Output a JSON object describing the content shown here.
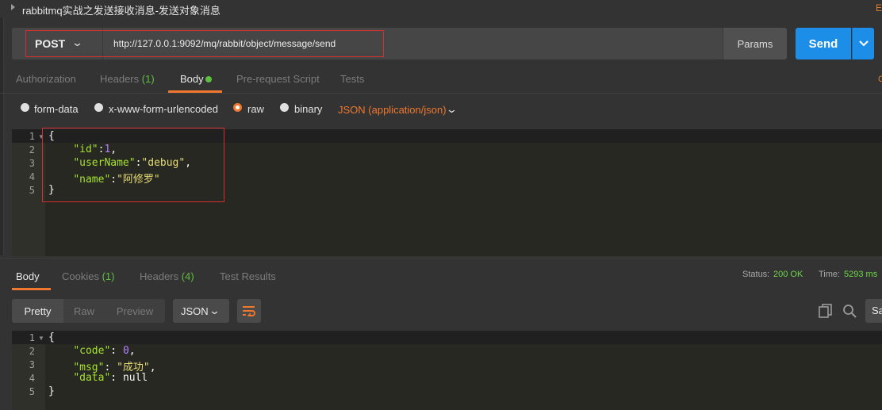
{
  "title": "rabbitmq实战之发送接收消息-发送对象消息",
  "title_right": "E",
  "request": {
    "method": "POST",
    "url": "http://127.0.0.1:9092/mq/rabbit/object/message/send",
    "params_label": "Params",
    "send_label": "Send"
  },
  "req_tabs": {
    "authorization": "Authorization",
    "headers": "Headers",
    "headers_count": "(1)",
    "body": "Body",
    "prerequest": "Pre-request Script",
    "tests": "Tests",
    "right_marker": "C"
  },
  "body_types": {
    "form_data": "form-data",
    "urlencoded": "x-www-form-urlencoded",
    "raw": "raw",
    "binary": "binary",
    "selected": "raw",
    "content_type": "JSON (application/json)"
  },
  "request_body": {
    "line_numbers": [
      "1",
      "2",
      "3",
      "4",
      "5"
    ],
    "l1": "{",
    "l2_key": "\"id\"",
    "l2_val": "1",
    "l3_key": "\"userName\"",
    "l3_val": "\"debug\"",
    "l4_key": "\"name\"",
    "l4_val": "\"阿修罗\"",
    "l5": "}"
  },
  "resp_tabs": {
    "body": "Body",
    "cookies": "Cookies",
    "cookies_count": "(1)",
    "headers": "Headers",
    "headers_count": "(4)",
    "test_results": "Test Results"
  },
  "status": {
    "status_label": "Status:",
    "status_value": "200 OK",
    "time_label": "Time:",
    "time_value": "5293 ms"
  },
  "view": {
    "pretty": "Pretty",
    "raw": "Raw",
    "preview": "Preview",
    "format": "JSON",
    "save_label": "Sa"
  },
  "response_body": {
    "line_numbers": [
      "1",
      "2",
      "3",
      "4",
      "5"
    ],
    "l1": "{",
    "l2_key": "\"code\"",
    "l2_val": "0",
    "l3_key": "\"msg\"",
    "l3_val": "\"成功\"",
    "l4_key": "\"data\"",
    "l4_val": "null",
    "l5": "}"
  },
  "colors": {
    "accent": "#f0782e",
    "send": "#1d8ee8",
    "success": "#5fbf3e",
    "highlight_box": "#d32f2f"
  }
}
